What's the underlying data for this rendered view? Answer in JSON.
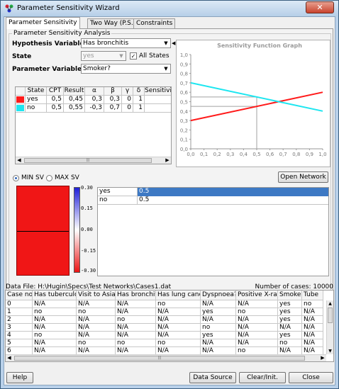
{
  "window": {
    "title": "Parameter Sensitivity Wizard",
    "close_label": "✕"
  },
  "tabs": [
    "Parameter Sensitivity",
    "Two Way (P.S.)",
    "Constraints"
  ],
  "analysis": {
    "group_title": "Parameter Sensitivity Analysis",
    "hypothesis_label": "Hypothesis Variable",
    "hypothesis_value": "Has bronchitis",
    "state_label": "State",
    "state_value": "yes",
    "all_states_label": "All States",
    "all_states_checked": true,
    "parameter_label": "Parameter Variable",
    "parameter_value": "Smoker?"
  },
  "param_table": {
    "columns": [
      "",
      "State",
      "CPT",
      "Result",
      "α",
      "β",
      "γ",
      "δ",
      "Sensitivity"
    ],
    "rows": [
      {
        "color": "#ff1a1a",
        "state": "yes",
        "cpt": "0,5",
        "result": "0,45",
        "alpha": "0,3",
        "beta": "0,3",
        "gamma": "0",
        "delta": "1",
        "sensitivity": ""
      },
      {
        "color": "#1ee6f0",
        "state": "no",
        "cpt": "0,5",
        "result": "0,55",
        "alpha": "-0,3",
        "beta": "0,7",
        "gamma": "0",
        "delta": "1",
        "sensitivity": ""
      }
    ]
  },
  "chart_data": {
    "type": "line",
    "title": "Sensitivity Function Graph",
    "xlim": [
      0,
      1
    ],
    "ylim": [
      0,
      1
    ],
    "x_ticks": [
      "0,0",
      "0,1",
      "0,2",
      "0,3",
      "0,4",
      "0,5",
      "0,6",
      "0,7",
      "0,8",
      "0,9",
      "1,0"
    ],
    "y_ticks": [
      "0,0",
      "0,1",
      "0,2",
      "0,3",
      "0,4",
      "0,5",
      "0,6",
      "0,7",
      "0,8",
      "0,9",
      "1,0"
    ],
    "series": [
      {
        "color": "#ff1a1a",
        "x": [
          0,
          1
        ],
        "y": [
          0.3,
          0.6
        ]
      },
      {
        "color": "#1ee6f0",
        "x": [
          0,
          1
        ],
        "y": [
          0.7,
          0.4
        ]
      }
    ],
    "guide_x": 0.5,
    "guide_y": [
      0.45,
      0.55
    ]
  },
  "sv_options": {
    "min_label": "MIN SV",
    "max_label": "MAX SV",
    "selected": "min"
  },
  "open_network_label": "Open Network",
  "colorbar_ticks": [
    "0.30",
    "0.15",
    "0.00",
    "-0.15",
    "-0.30"
  ],
  "sv_table": [
    {
      "state": "yes",
      "value": "0.5",
      "selected": true
    },
    {
      "state": "no",
      "value": "0.5",
      "selected": false
    }
  ],
  "data_file": {
    "label": "Data File: H:\\Hugin\\Specs\\Test Networks\\Cases1.dat",
    "cases_label": "Number of cases: 10000"
  },
  "data_table": {
    "columns": [
      "Case no.",
      "Has tuberculosis",
      "Visit to Asia?",
      "Has bronchitis",
      "Has lung cancer",
      "Dyspnoea?",
      "Positive X-ray?",
      "Smoker?",
      "Tube"
    ],
    "rows": [
      [
        "0",
        "N/A",
        "N/A",
        "N/A",
        "no",
        "N/A",
        "N/A",
        "yes",
        "no"
      ],
      [
        "1",
        "no",
        "no",
        "N/A",
        "N/A",
        "yes",
        "no",
        "yes",
        "N/A"
      ],
      [
        "2",
        "N/A",
        "N/A",
        "no",
        "N/A",
        "N/A",
        "N/A",
        "yes",
        "N/A"
      ],
      [
        "3",
        "N/A",
        "N/A",
        "N/A",
        "N/A",
        "no",
        "N/A",
        "N/A",
        "N/A"
      ],
      [
        "4",
        "no",
        "N/A",
        "N/A",
        "N/A",
        "yes",
        "N/A",
        "yes",
        "N/A"
      ],
      [
        "5",
        "N/A",
        "no",
        "no",
        "no",
        "N/A",
        "N/A",
        "no",
        "N/A"
      ],
      [
        "6",
        "N/A",
        "N/A",
        "N/A",
        "N/A",
        "N/A",
        "no",
        "N/A",
        "N/A"
      ]
    ]
  },
  "footer": {
    "help_label": "Help",
    "data_source_label": "Data Source",
    "clear_label": "Clear/Init.",
    "close_label": "Close"
  }
}
